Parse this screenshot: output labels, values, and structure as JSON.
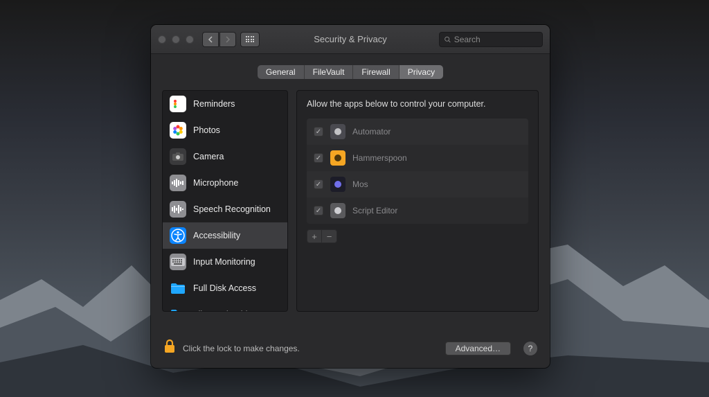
{
  "window": {
    "title": "Security & Privacy"
  },
  "search": {
    "placeholder": "Search"
  },
  "tabs": [
    {
      "label": "General",
      "active": false
    },
    {
      "label": "FileVault",
      "active": false
    },
    {
      "label": "Firewall",
      "active": false
    },
    {
      "label": "Privacy",
      "active": true
    }
  ],
  "sidebar": {
    "items": [
      {
        "label": "Reminders",
        "icon": "reminders-icon",
        "bg": "#ffffff",
        "fg": "#ff3b30",
        "active": false
      },
      {
        "label": "Photos",
        "icon": "photos-icon",
        "bg": "#ffffff",
        "fg": "#ff2d55",
        "active": false
      },
      {
        "label": "Camera",
        "icon": "camera-icon",
        "bg": "#3a3a3c",
        "fg": "#ffffff",
        "active": false
      },
      {
        "label": "Microphone",
        "icon": "microphone-icon",
        "bg": "#8e8e92",
        "fg": "#ffffff",
        "active": false
      },
      {
        "label": "Speech Recognition",
        "icon": "speech-icon",
        "bg": "#8e8e92",
        "fg": "#ffffff",
        "active": false
      },
      {
        "label": "Accessibility",
        "icon": "accessibility-icon",
        "bg": "#0a84ff",
        "fg": "#ffffff",
        "active": true
      },
      {
        "label": "Input Monitoring",
        "icon": "keyboard-icon",
        "bg": "#8e8e92",
        "fg": "#ffffff",
        "active": false
      },
      {
        "label": "Full Disk Access",
        "icon": "folder-icon",
        "bg": "transparent",
        "fg": "#1fa7ff",
        "active": false
      },
      {
        "label": "Files and Folders",
        "icon": "folder-icon",
        "bg": "transparent",
        "fg": "#1fa7ff",
        "active": false
      }
    ]
  },
  "detail": {
    "heading": "Allow the apps below to control your computer.",
    "apps": [
      {
        "name": "Automator",
        "checked": true,
        "icon_bg": "#4a4a50",
        "icon_fg": "#cfcfd2"
      },
      {
        "name": "Hammerspoon",
        "checked": true,
        "icon_bg": "#f5a623",
        "icon_fg": "#3a2a0a"
      },
      {
        "name": "Mos",
        "checked": true,
        "icon_bg": "#1c1c28",
        "icon_fg": "#7a78ff"
      },
      {
        "name": "Script Editor",
        "checked": true,
        "icon_bg": "#5a5a5d",
        "icon_fg": "#dcdce0"
      }
    ]
  },
  "footer": {
    "lock_message": "Click the lock to make changes.",
    "advanced_label": "Advanced…"
  }
}
